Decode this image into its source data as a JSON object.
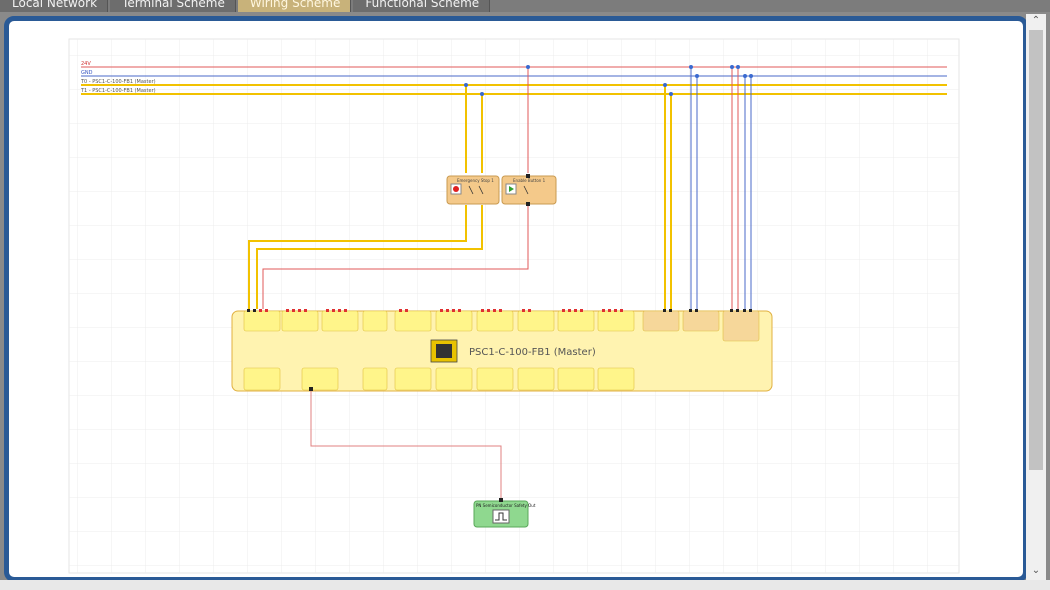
{
  "tabs": [
    {
      "label": "Local Network",
      "active": false
    },
    {
      "label": "Terminal Scheme",
      "active": false
    },
    {
      "label": "Wiring Scheme",
      "active": true
    },
    {
      "label": "Functional Scheme",
      "active": false
    }
  ],
  "rails": {
    "v24": "24V",
    "gnd": "GND",
    "t0": "T0 - PSC1-C-100-FB1 (Master)",
    "t1": "T1 - PSC1-C-100-FB1 (Master)"
  },
  "colors": {
    "red_wire": "#e05a5a",
    "blue_wire": "#4a68c8",
    "yellow_wire": "#f2c200",
    "module_fill": "#fff3b0",
    "device_fill": "#f4c98a",
    "green_fill": "#8fd88f"
  },
  "controller": {
    "label": "PSC1-C-100-FB1 (Master)"
  },
  "devices": {
    "emergency_stop": "Emergency Stop 1",
    "enable_button": "Enable Button 1",
    "safety_output": "PN Semiconductor Safety Out"
  },
  "icons": {
    "controller": "controller-chip-icon",
    "estop": "emergency-stop-icon",
    "enable": "enable-button-icon",
    "output": "pulse-output-icon"
  },
  "scroll": {
    "up": "⌃",
    "down": "⌄"
  }
}
